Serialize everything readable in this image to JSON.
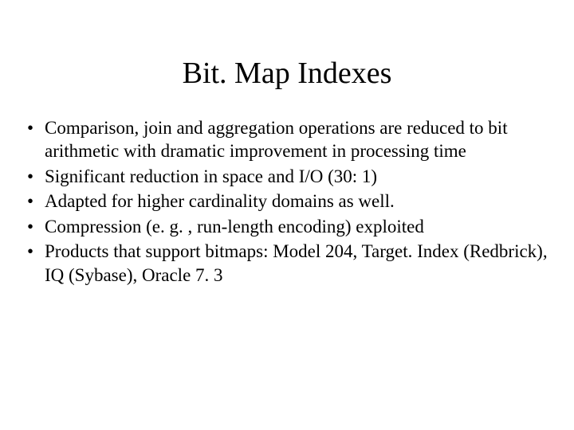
{
  "title": "Bit. Map Indexes",
  "bullets": [
    "Comparison, join and aggregation operations are reduced to bit arithmetic with dramatic improvement in processing time",
    "Significant reduction in space and I/O (30: 1)",
    "Adapted for higher cardinality domains as well.",
    "Compression (e. g. , run-length encoding) exploited",
    "Products that support bitmaps:  Model 204, Target. Index (Redbrick), IQ (Sybase), Oracle 7. 3"
  ]
}
